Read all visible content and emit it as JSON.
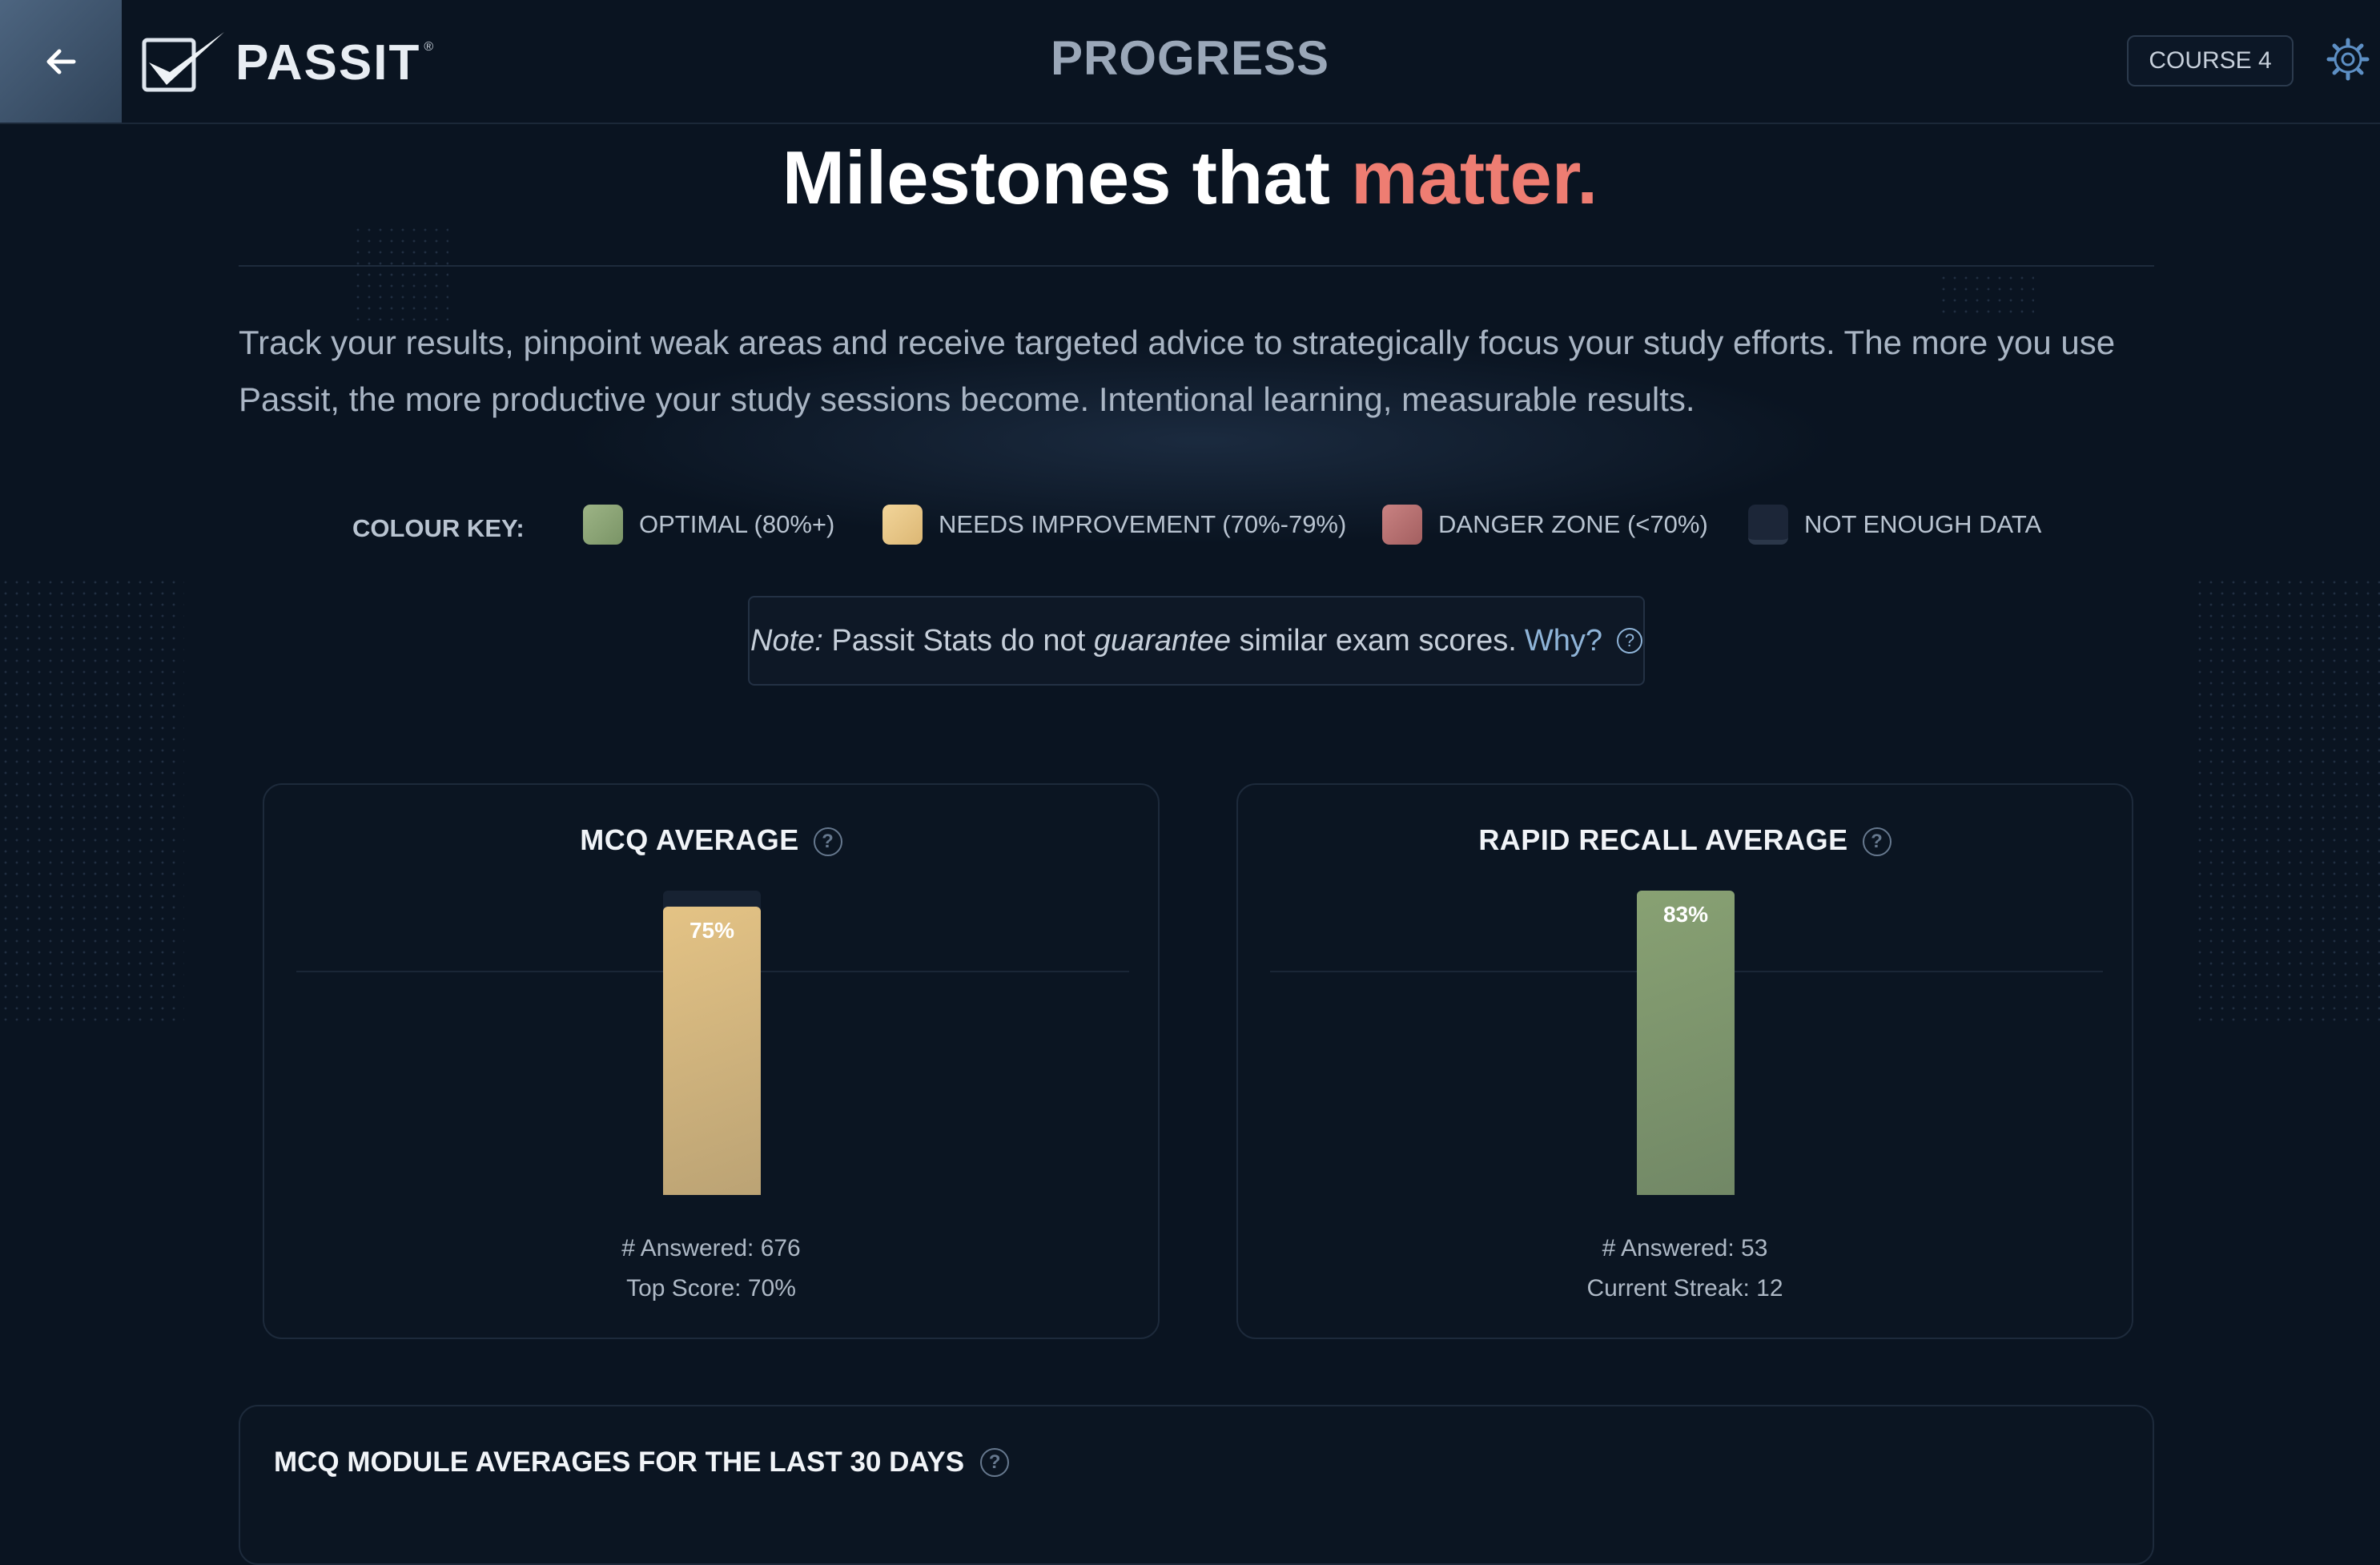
{
  "header": {
    "logo_text": "PASSIT",
    "logo_reg": "®",
    "page_title": "PROGRESS",
    "course_label": "COURSE 4"
  },
  "hero": {
    "headline_main": "Milestones that",
    "headline_accent": "matter.",
    "intro": "Track your results, pinpoint weak areas and receive targeted advice to strategically focus your study efforts. The more you use Passit, the more productive your study sessions become. Intentional learning, measurable results."
  },
  "colour_key": {
    "label": "COLOUR KEY:",
    "items": [
      {
        "label": "OPTIMAL (80%+)",
        "color": "#88a173"
      },
      {
        "label": "NEEDS IMPROVEMENT (70%-79%)",
        "color": "#e4c385"
      },
      {
        "label": "DANGER ZONE (<70%)",
        "color": "#b46f6f"
      },
      {
        "label": "NOT ENOUGH DATA",
        "color": "#1c2638"
      }
    ]
  },
  "note": {
    "prefix": "Note:",
    "text1": "Passit Stats do not",
    "emphasis": "guarantee",
    "text2": "similar exam scores.",
    "link": "Why?",
    "help_glyph": "?"
  },
  "cards": [
    {
      "title": "MCQ AVERAGE",
      "value_label": "75%",
      "value": 75,
      "color": "#e4c385",
      "stat1": "# Answered: 676",
      "stat2": "Top Score: 70%"
    },
    {
      "title": "RAPID RECALL AVERAGE",
      "value_label": "83%",
      "value": 83,
      "color": "#88a173",
      "stat1": "# Answered: 53",
      "stat2": "Current Streak: 12"
    }
  ],
  "module_panel": {
    "title": "MCQ MODULE AVERAGES FOR THE LAST 30 DAYS"
  }
}
